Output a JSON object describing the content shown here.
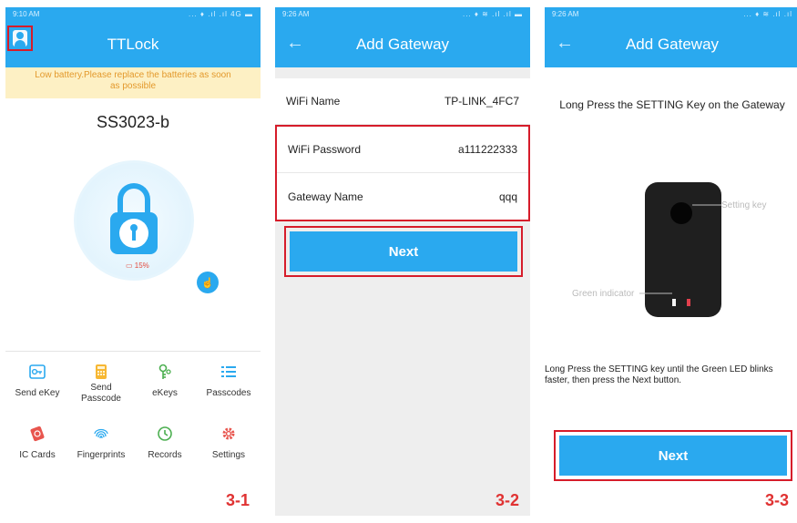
{
  "screen1": {
    "status_time": "9:10 AM",
    "status_icons": "... ♦ .ıl .ıl 4G ▬",
    "title": "TTLock",
    "banner": "Low battery.Please replace the batteries as soon as possible",
    "lock_name": "SS3023-b",
    "battery_level": "15%",
    "menu": [
      {
        "label": "Send eKey",
        "icon": "send-ekey-icon"
      },
      {
        "label": "Send Passcode",
        "icon": "send-passcode-icon"
      },
      {
        "label": "eKeys",
        "icon": "ekeys-icon"
      },
      {
        "label": "Passcodes",
        "icon": "passcodes-icon"
      },
      {
        "label": "IC Cards",
        "icon": "ic-card-icon"
      },
      {
        "label": "Fingerprints",
        "icon": "fingerprint-icon"
      },
      {
        "label": "Records",
        "icon": "records-icon"
      },
      {
        "label": "Settings",
        "icon": "settings-icon"
      }
    ],
    "step_label": "3-1"
  },
  "screen2": {
    "status_time": "9:26 AM",
    "status_icons": "... ♦ ≋ .ıl .ıl ▬",
    "title": "Add Gateway",
    "wifi_name_label": "WiFi Name",
    "wifi_name_value": "TP-LINK_4FC7",
    "wifi_password_label": "WiFi Password",
    "wifi_password_value": "a111222333",
    "gateway_name_label": "Gateway Name",
    "gateway_name_value": "qqq",
    "next_label": "Next",
    "step_label": "3-2"
  },
  "screen3": {
    "status_time": "9:26 AM",
    "status_icons": "... ♦ ≋ .ıl .ıl",
    "title": "Add Gateway",
    "instruction_title": "Long Press the SETTING Key on the Gateway",
    "callout_setting": "Setting key",
    "callout_indicator": "Green indicator",
    "instruction_body": "Long Press the SETTING key until the Green LED blinks faster, then press the Next button.",
    "next_label": "Next",
    "step_label": "3-3"
  },
  "colors": {
    "primary": "#2aa9ef",
    "highlight_border": "#d61c2a",
    "banner_bg": "#fdf0c4",
    "step_label": "#e03232"
  }
}
